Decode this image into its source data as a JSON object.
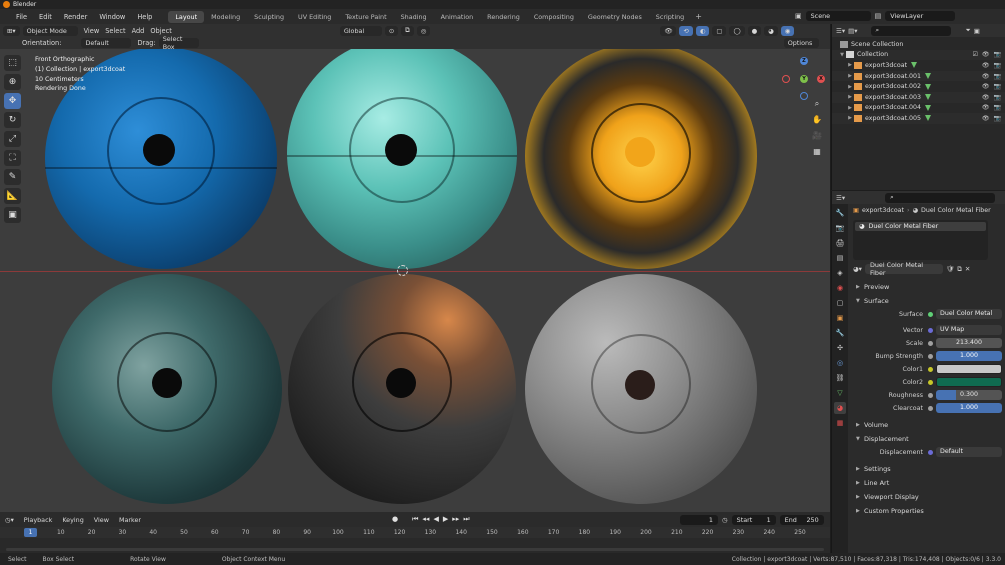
{
  "window": {
    "title": "Blender"
  },
  "menu": {
    "items": [
      "File",
      "Edit",
      "Render",
      "Window",
      "Help"
    ],
    "workspaces": [
      "Layout",
      "Modeling",
      "Sculpting",
      "UV Editing",
      "Texture Paint",
      "Shading",
      "Animation",
      "Rendering",
      "Compositing",
      "Geometry Nodes",
      "Scripting"
    ],
    "active_workspace": "Layout",
    "scene": "Scene",
    "view_layer": "ViewLayer"
  },
  "viewport_header": {
    "mode": "Object Mode",
    "menus": [
      "View",
      "Select",
      "Add",
      "Object"
    ],
    "transform": "Global",
    "orientation_label": "Orientation:",
    "orientation_value": "Default",
    "drag_label": "Drag:",
    "drag_value": "Select Box",
    "options": "Options"
  },
  "viewport_overlay": {
    "line1": "Front Orthographic",
    "line2": "(1) Collection | export3dcoat",
    "line3": "10 Centimeters",
    "line4": "Rendering Done"
  },
  "gizmo": {
    "x": "X",
    "y": "Y",
    "z": "Z"
  },
  "timeline": {
    "menus": [
      "Playback",
      "Keying",
      "View",
      "Marker"
    ],
    "current_frame": "1",
    "start_label": "Start",
    "start": "1",
    "end_label": "End",
    "end": "250",
    "ticks": [
      "1",
      "10",
      "20",
      "30",
      "40",
      "50",
      "60",
      "70",
      "80",
      "90",
      "100",
      "110",
      "120",
      "130",
      "140",
      "150",
      "160",
      "170",
      "180",
      "190",
      "200",
      "210",
      "220",
      "230",
      "240",
      "250"
    ]
  },
  "status": {
    "select": "Select",
    "box_select": "Box Select",
    "rotate_view": "Rotate View",
    "context_menu": "Object Context Menu",
    "stats": "Collection | export3dcoat | Verts:87,510 | Faces:87,318 | Tris:174,408 | Objects:0/6 | 3.3.0"
  },
  "outliner": {
    "root": "Scene Collection",
    "collection": "Collection",
    "objects": [
      "export3dcoat",
      "export3dcoat.001",
      "export3dcoat.002",
      "export3dcoat.003",
      "export3dcoat.004",
      "export3dcoat.005"
    ]
  },
  "properties": {
    "breadcrumb_object": "export3dcoat",
    "breadcrumb_material": "Duel Color Metal Fiber",
    "slot": "Duel Color Metal Fiber",
    "material_name": "Duel Color Metal Fiber",
    "sections": {
      "preview": "Preview",
      "surface": "Surface",
      "volume": "Volume",
      "displacement": "Displacement",
      "settings": "Settings",
      "line_art": "Line Art",
      "viewport_display": "Viewport Display",
      "custom_properties": "Custom Properties"
    },
    "rows": {
      "surface_label": "Surface",
      "surface_value": "Duel Color Metal Fiber",
      "vector_label": "Vector",
      "vector_value": "UV Map",
      "scale_label": "Scale",
      "scale_value": "213.400",
      "bump_label": "Bump Strength",
      "bump_value": "1.000",
      "color1_label": "Color1",
      "color2_label": "Color2",
      "roughness_label": "Roughness",
      "roughness_value": "0.300",
      "clearcoat_label": "Clearcoat",
      "clearcoat_value": "1.000",
      "displacement_label": "Displacement",
      "displacement_value": "Default"
    },
    "color1": "#c8c8c8",
    "color2": "#0f6b50"
  },
  "colors": {
    "accent": "#4772b3",
    "header": "#303030",
    "viewport": "#3d3d3d"
  }
}
